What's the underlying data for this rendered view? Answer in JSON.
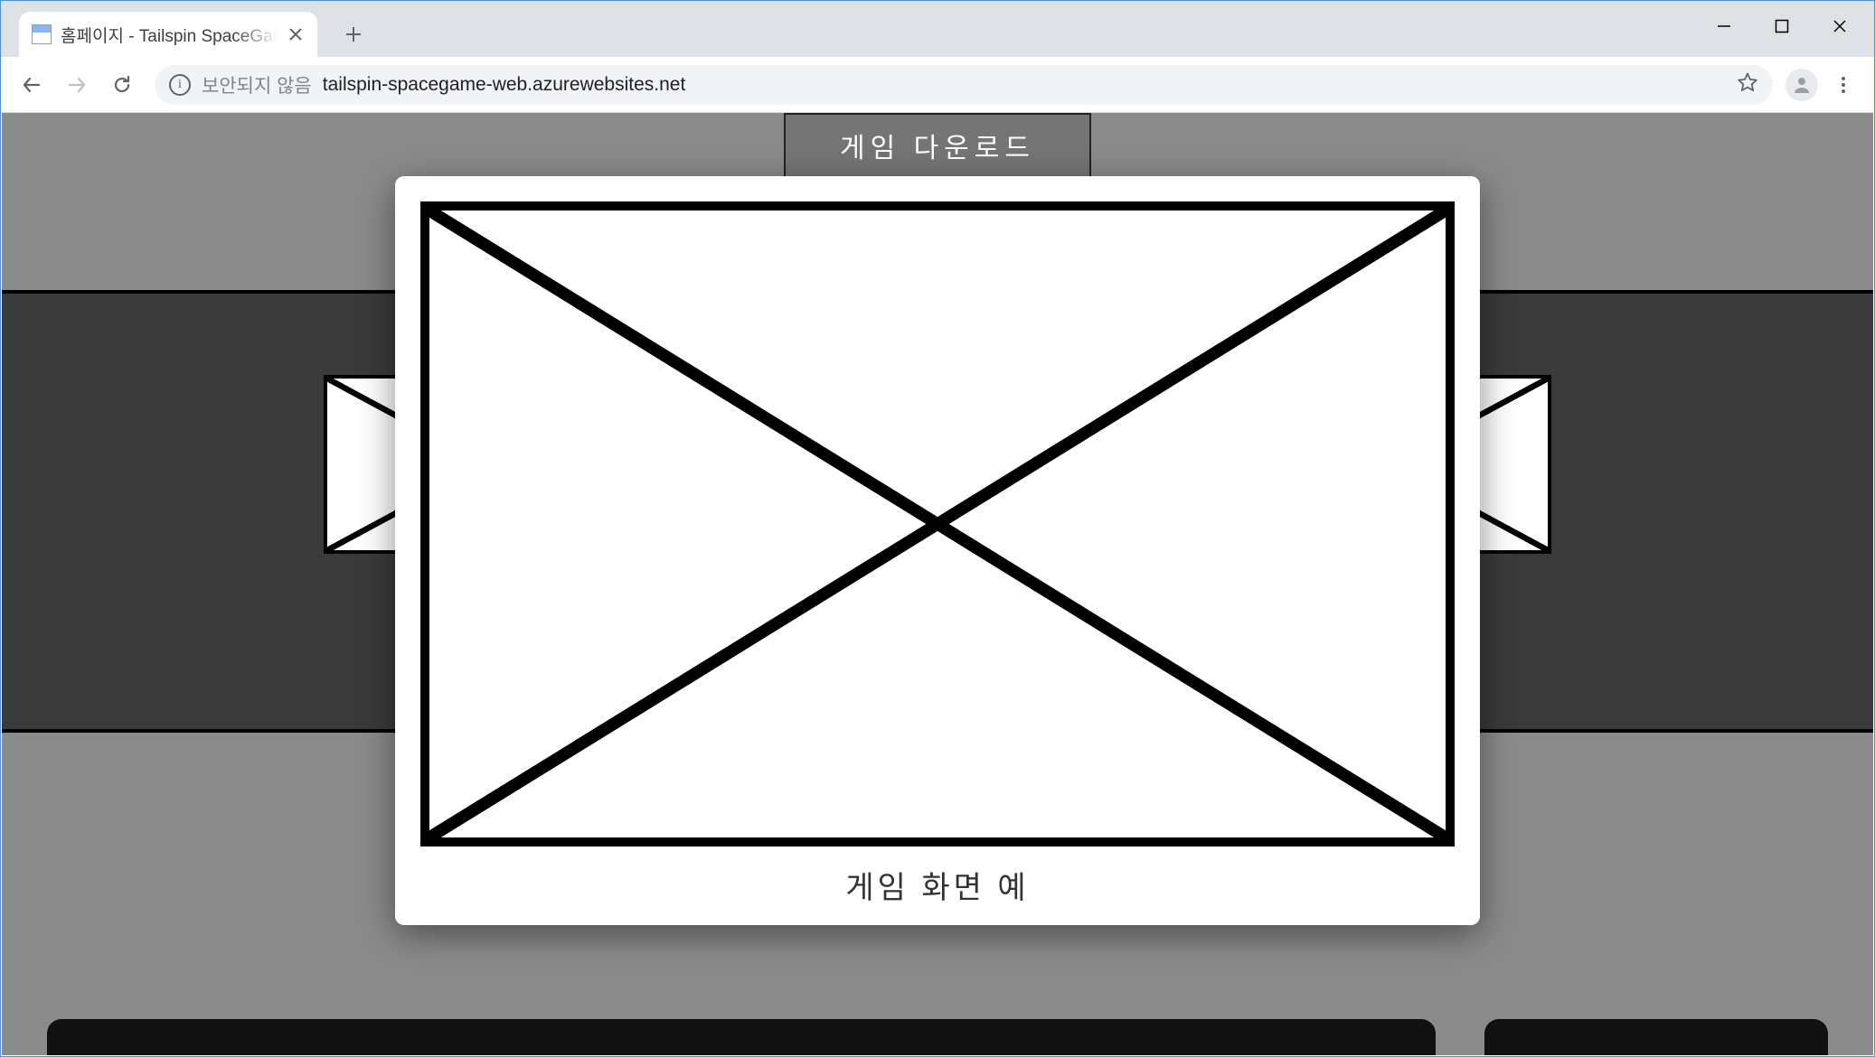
{
  "browser": {
    "tab_title": "홈페이지 - Tailspin SpaceGame",
    "security_label": "보안되지 않음",
    "url": "tailspin-spacegame-web.azurewebsites.net"
  },
  "page": {
    "download_button": "게임 다운로드",
    "modal_caption": "게임 화면 예"
  }
}
